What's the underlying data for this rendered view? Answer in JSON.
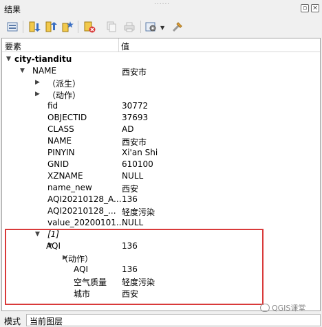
{
  "panel": {
    "title": "结果",
    "grip": "......"
  },
  "toolbar": {
    "icons": [
      "expand-tree-icon",
      "collapse-down-icon",
      "collapse-up-icon",
      "star-icon",
      "clear-results-icon",
      "copy-icon",
      "print-icon",
      "settings-dropdown-icon",
      "tools-icon"
    ]
  },
  "header": {
    "col1": "要素",
    "col2": "值"
  },
  "rows": [
    {
      "name": "city-tianditu",
      "value": "",
      "depth": 0,
      "arrow": "down",
      "bold": true
    },
    {
      "name": "NAME",
      "value": "西安市",
      "depth": 1,
      "arrow": "down"
    },
    {
      "name": "（派生）",
      "value": "",
      "depth": 2,
      "arrow": "right"
    },
    {
      "name": "（动作）",
      "value": "",
      "depth": 2,
      "arrow": "right"
    },
    {
      "name": "fid",
      "value": "30772",
      "depth": 3
    },
    {
      "name": "OBJECTID",
      "value": "37693",
      "depth": 3
    },
    {
      "name": "CLASS",
      "value": "AD",
      "depth": 3
    },
    {
      "name": "NAME",
      "value": "西安市",
      "depth": 3
    },
    {
      "name": "PINYIN",
      "value": "Xi'an Shi",
      "depth": 3
    },
    {
      "name": "GNID",
      "value": "610100",
      "depth": 3
    },
    {
      "name": "XZNAME",
      "value": "NULL",
      "depth": 3
    },
    {
      "name": "name_new",
      "value": "西安",
      "depth": 3
    },
    {
      "name": "AQI20210128_A...",
      "value": "136",
      "depth": 3
    },
    {
      "name": "AQI20210128_...",
      "value": "轻度污染",
      "depth": 3
    },
    {
      "name": "value_20200101...",
      "value": "NULL",
      "depth": 3
    },
    {
      "name": "[1]",
      "value": "",
      "depth": 3,
      "arrow": "down",
      "italic": true
    },
    {
      "name": "AQI",
      "value": "136",
      "depth": 4,
      "arrow": "down"
    },
    {
      "name": "（动作）",
      "value": "",
      "depth": 5,
      "arrow": "right"
    },
    {
      "name": "AQI",
      "value": "136",
      "depth": 6
    },
    {
      "name": "空气质量",
      "value": "轻度污染",
      "depth": 6
    },
    {
      "name": "城市",
      "value": "西安",
      "depth": 6
    }
  ],
  "bottom": {
    "mode_label": "模式",
    "mode_value": "当前图层"
  },
  "watermark": "QGIS课堂",
  "colors": {
    "highlight": "#d93a3a"
  }
}
